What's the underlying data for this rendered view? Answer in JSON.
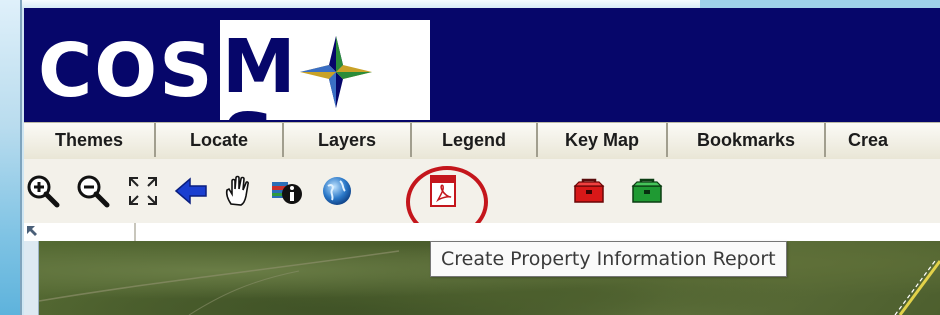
{
  "app": {
    "logo_left": "COS",
    "logo_right": "S",
    "logo_boxed_letter": "M"
  },
  "menu": {
    "items": [
      {
        "label": "Themes"
      },
      {
        "label": "Locate"
      },
      {
        "label": "Layers"
      },
      {
        "label": "Legend"
      },
      {
        "label": "Key Map"
      },
      {
        "label": "Bookmarks"
      },
      {
        "label": "Crea"
      }
    ]
  },
  "toolbar": {
    "buttons": [
      {
        "icon": "zoom-in-icon"
      },
      {
        "icon": "zoom-out-icon"
      },
      {
        "icon": "full-extent-icon"
      },
      {
        "icon": "back-arrow-icon"
      },
      {
        "icon": "pan-hand-icon"
      },
      {
        "icon": "identify-info-icon"
      },
      {
        "icon": "globe-icon"
      },
      {
        "icon": "pdf-report-icon"
      },
      {
        "icon": "red-toolbox-icon"
      },
      {
        "icon": "green-toolbox-icon"
      }
    ]
  },
  "tooltip": {
    "text": "Create Property Information Report"
  },
  "colors": {
    "header_bg": "#06066a",
    "highlight_ring": "#c4161c"
  }
}
